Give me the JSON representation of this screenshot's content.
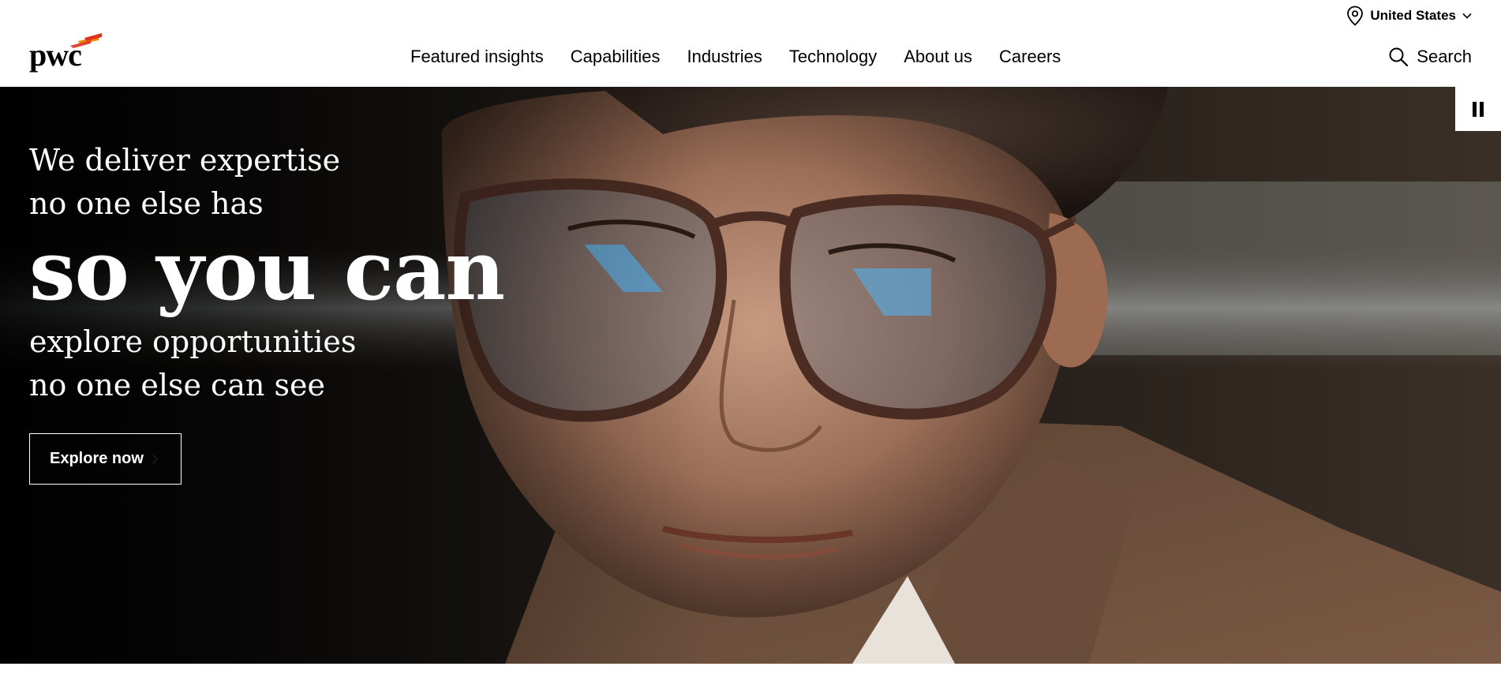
{
  "header": {
    "region_label": "United States",
    "region_icon": "location-pin-icon",
    "logo_text": "pwc",
    "nav": [
      {
        "label": "Featured insights"
      },
      {
        "label": "Capabilities"
      },
      {
        "label": "Industries"
      },
      {
        "label": "Technology"
      },
      {
        "label": "About us"
      },
      {
        "label": "Careers"
      }
    ],
    "search_label": "Search",
    "search_icon": "magnifier-icon"
  },
  "hero": {
    "line1": "We deliver expertise",
    "line2": "no one else has",
    "headline": "so you can",
    "line3": "explore opportunities",
    "line4": "no one else can see",
    "cta_label": "Explore now",
    "pause_icon": "pause-icon"
  },
  "colors": {
    "brand_orange": "#e0301e",
    "brand_orange_light": "#eb8c00",
    "text": "#000000",
    "hero_text": "#ffffff"
  }
}
